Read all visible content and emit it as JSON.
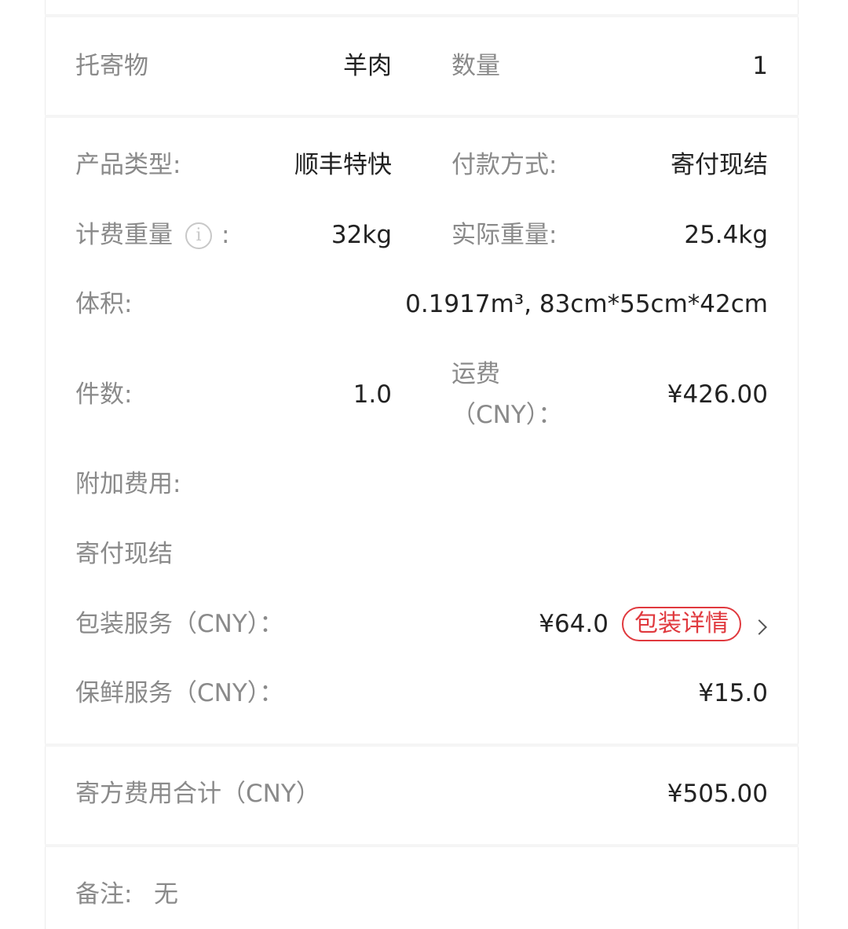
{
  "goods": {
    "label": "托寄物",
    "value": "羊肉",
    "qty_label": "数量",
    "qty_value": "1"
  },
  "details": {
    "product_type_label": "产品类型:",
    "product_type_value": "顺丰特快",
    "payment_label": "付款方式:",
    "payment_value": "寄付现结",
    "billing_weight_label": "计费重量",
    "billing_weight_colon": ":",
    "billing_weight_value": "32kg",
    "actual_weight_label": "实际重量:",
    "actual_weight_value": "25.4kg",
    "volume_label": "体积:",
    "volume_value": "0.1917m³, 83cm*55cm*42cm",
    "pieces_label": "件数:",
    "pieces_value": "1.0",
    "freight_label_line1": "运费",
    "freight_label_line2": "（CNY）：",
    "freight_value": "¥426.00",
    "extra_fees_label": "附加费用:",
    "extra_fees_method": "寄付现结",
    "packing_label": "包装服务（CNY）：",
    "packing_value": "¥64.0",
    "packing_detail_button": "包装详情",
    "fresh_label": "保鲜服务（CNY）：",
    "fresh_value": "¥15.0"
  },
  "total": {
    "label": "寄方费用合计（CNY）",
    "value": "¥505.00"
  },
  "remarks": {
    "label": "备注:",
    "value": "无"
  },
  "icons": {
    "info": "info-icon",
    "detail_arrow": "chevron-right-icon"
  },
  "colors": {
    "accent": "#e0393e",
    "label": "#8a8a8a",
    "value": "#222222"
  }
}
